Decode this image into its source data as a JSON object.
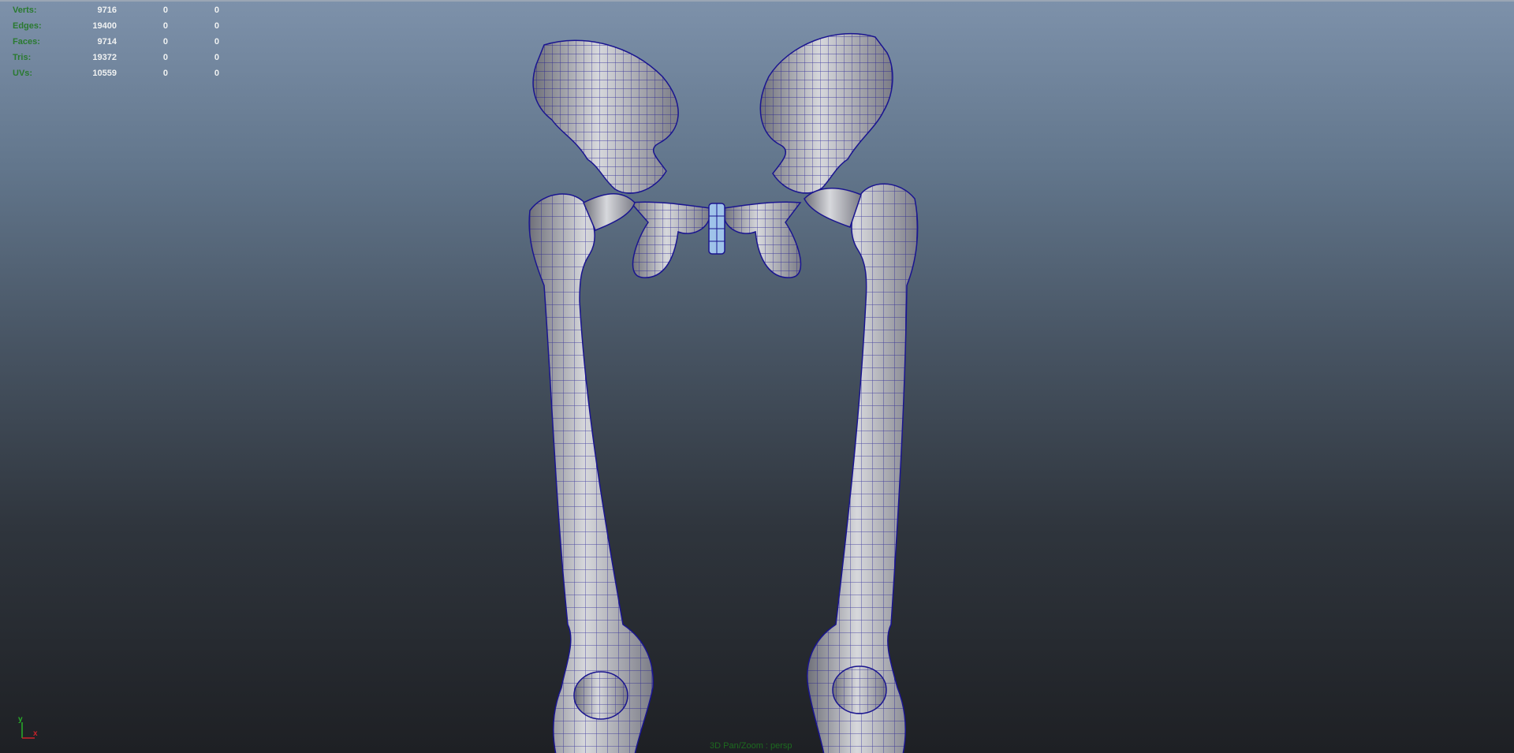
{
  "viewport": {
    "camera_label": "3D Pan/Zoom : persp",
    "axis": {
      "y_label": "y",
      "x_label": "x"
    },
    "gradient_top": "#7d91aa",
    "gradient_bottom": "#1e2024",
    "mesh_fill": "#b9b9c0",
    "wire_color": "#1a1590",
    "hud_label_color": "#2a7a30"
  },
  "hud": {
    "rows": [
      {
        "label": "Verts:",
        "v1": "9716",
        "v2": "0",
        "v3": "0"
      },
      {
        "label": "Edges:",
        "v1": "19400",
        "v2": "0",
        "v3": "0"
      },
      {
        "label": "Faces:",
        "v1": "9714",
        "v2": "0",
        "v3": "0"
      },
      {
        "label": "Tris:",
        "v1": "19372",
        "v2": "0",
        "v3": "0"
      },
      {
        "label": "UVs:",
        "v1": "10559",
        "v2": "0",
        "v3": "0"
      }
    ]
  }
}
